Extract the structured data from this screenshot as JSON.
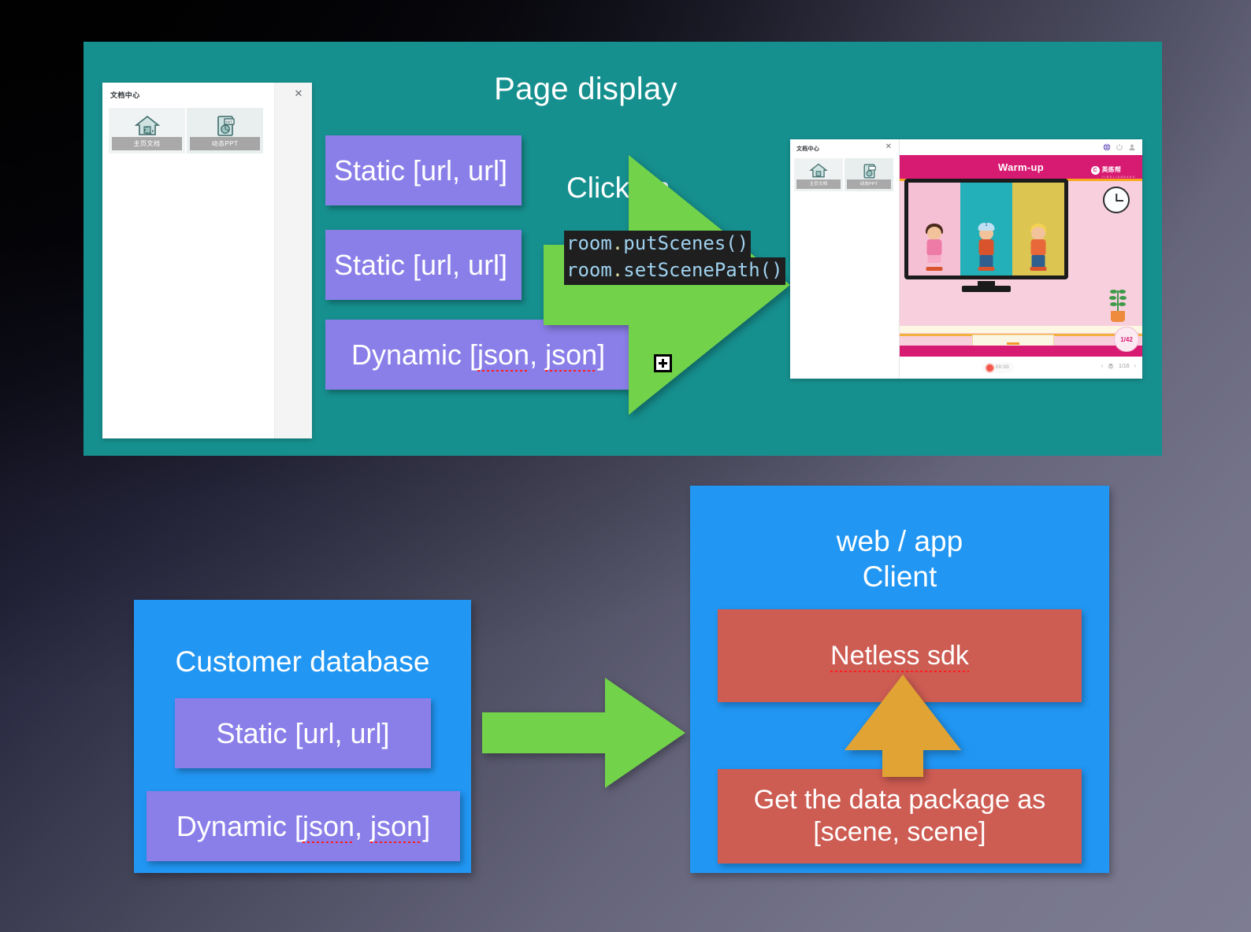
{
  "slide": {
    "background_top_left": "#07070b",
    "background_bottom_right": "#7d7c92"
  },
  "top_panel": {
    "background": "#16908f",
    "title": "Page display",
    "doc_window": {
      "title": "文档中心",
      "close_icon": "close-icon",
      "tabs": [
        {
          "label": "主页文档",
          "icon": "upload-document-icon"
        },
        {
          "label": "动态PPT",
          "icon": "ppt-document-icon"
        }
      ]
    },
    "callouts": [
      {
        "name": "static-urls-1",
        "text": "Static [url, url]",
        "color": "#8a7fe8"
      },
      {
        "name": "static-urls-2",
        "text": "Static [url, url]",
        "color": "#8a7fe8"
      },
      {
        "name": "dynamic-json-1",
        "text_before": "Dynamic [",
        "spell_1": "json",
        "mid": ", ",
        "spell_2": "json",
        "text_after": "]",
        "color": "#8a7fe8"
      }
    ],
    "click_on_label": "Click on",
    "code_block": {
      "lines": [
        {
          "object": "room",
          "dot": ".",
          "call": "putScenes()"
        },
        {
          "object": "room",
          "dot": ".",
          "call": "setScenePath()"
        }
      ],
      "background": "#1f1f1f",
      "object_color": "#9fd2ef",
      "call_color": "#9fd2ef",
      "dot_color": "#e6dfa8"
    },
    "arrow": {
      "name": "flow-arrow-right",
      "color": "#72d34b"
    },
    "resize_handle": {
      "name": "plus-handle-icon",
      "glyph": "+"
    },
    "screenshot": {
      "left_panel": {
        "title": "文档中心",
        "close_icon": "close-icon",
        "tabs": [
          {
            "label": "主页文档",
            "icon": "upload-document-icon"
          },
          {
            "label": "动态PPT",
            "icon": "ppt-document-icon"
          }
        ]
      },
      "toolbar_icons": [
        "globe-icon",
        "power-icon",
        "person-icon"
      ],
      "slide": {
        "header_title": "Warm-up",
        "logo_word": "英练帮",
        "logo_sub": "YINGLIANBANG",
        "page_badge": "1/42",
        "characters": [
          {
            "name": "girl-character"
          },
          {
            "name": "boy-cap-character",
            "cap_number": "1"
          },
          {
            "name": "boy-blond-character"
          }
        ],
        "props": [
          "tv-monitor",
          "wall-clock",
          "potted-plant",
          "shelf",
          "drawer"
        ]
      },
      "status_bar": {
        "record_icon": "record-icon",
        "record_time": "00:00",
        "pager_prev": "‹",
        "pager_icon": "layers-icon",
        "pager_value": "1/16",
        "pager_next": "›"
      }
    }
  },
  "bottom_left_box": {
    "name": "customer-database",
    "background": "#2196f3",
    "title": "Customer database",
    "callouts": [
      {
        "name": "static-urls-3",
        "text": "Static [url, url]",
        "color": "#8a7fe8"
      },
      {
        "name": "dynamic-json-2",
        "text_before": "Dynamic [",
        "spell_1": "json",
        "mid": ", ",
        "spell_2": "json",
        "text_after": "]",
        "color": "#8a7fe8"
      }
    ]
  },
  "middle_arrow": {
    "name": "db-to-client-arrow",
    "color": "#72d34b"
  },
  "bottom_right_box": {
    "name": "web-app-client",
    "background": "#2196f3",
    "title_line_1": "web / app",
    "title_line_2": "Client",
    "sdk_box": {
      "name": "netless-sdk",
      "text": "Netless sdk",
      "spell": "Netless sdk",
      "color": "#cd5c53"
    },
    "data_box": {
      "name": "get-data-package",
      "line_1": "Get the data package as",
      "line_2": "[scene, scene]",
      "color": "#cd5c53"
    },
    "up_arrow": {
      "name": "data-to-sdk-arrow",
      "color": "#e0a334"
    }
  }
}
